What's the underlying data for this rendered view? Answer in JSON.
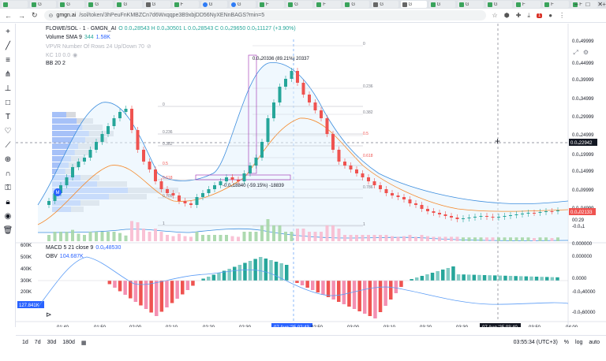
{
  "browser": {
    "tabs": [
      {
        "icon": "green",
        "label": ""
      },
      {
        "icon": "green",
        "label": "G"
      },
      {
        "icon": "green",
        "label": "G"
      },
      {
        "icon": "green",
        "label": "G"
      },
      {
        "icon": "green",
        "label": "G"
      },
      {
        "icon": "grey",
        "label": "G"
      },
      {
        "icon": "green",
        "label": "F"
      },
      {
        "icon": "blue",
        "label": "G"
      },
      {
        "icon": "blue",
        "label": "G"
      },
      {
        "icon": "green",
        "label": "F"
      },
      {
        "icon": "green",
        "label": "G"
      },
      {
        "icon": "green",
        "label": "F"
      },
      {
        "icon": "green",
        "label": "G"
      },
      {
        "icon": "grey",
        "label": "G"
      },
      {
        "icon": "grey",
        "label": "G"
      },
      {
        "icon": "green",
        "label": "G"
      },
      {
        "icon": "green",
        "label": "G"
      },
      {
        "icon": "green",
        "label": "G"
      },
      {
        "icon": "green",
        "label": "F"
      },
      {
        "icon": "green",
        "label": "F"
      },
      {
        "icon": "green",
        "label": "F"
      }
    ],
    "url_host": "gmgn.ai",
    "url_path": "/sol/token/3hPeuFnKMBZCn7d6Wxqqpe3B9xbjDD56NyXENnBAGS?min=5",
    "notif_badge": "1"
  },
  "legend": {
    "symbol": "FLOWE/SOL · 1 · GMGN_AI",
    "ohlc": "O 0.0₄28543 H 0.0₄30501 L 0.0₄28543 C 0.0₄29650 0.0₅11127 (+3.90%)",
    "volume_label": "Volume SMA 9",
    "volume_val1": "344",
    "volume_val2": "1.58K",
    "vpvr_label": "VPVR Number Of Rows 24 Up/Down 70",
    "kc_label": "KC 10 0.0",
    "bb_label": "BB 20 2",
    "macd_label": "MACD 5 21 close 9",
    "macd_val": "0.0₆48530",
    "obv_label": "OBV",
    "obv_val": "104.687K"
  },
  "chart_data": {
    "type": "candlestick",
    "title": "FLOWE/SOL · 1 · GMGN_AI",
    "x_ticks": [
      "01:40",
      "01:50",
      "02:00",
      "02:10",
      "02:20",
      "02:30",
      "07 Aug '25  02:43",
      "02:50",
      "03:00",
      "03:10",
      "03:20",
      "03:30",
      "07 Aug '25  03:40",
      "03:50",
      "04:00"
    ],
    "y_ticks_price": [
      "0.0₄49999",
      "0.0₄44999",
      "0.0₄39999",
      "0.0₄34999",
      "0.0₄29999",
      "0.0₄24999",
      "0.0₄22942",
      "0.0₄19999",
      "0.0₄14999",
      "0.0₄09999",
      "0.0₄04999",
      "0.0₄02133",
      "00:29",
      "-0.0₄1",
      "0.000000"
    ],
    "y_ticks_macd": [
      "0.000000",
      "0.0000",
      "-0.0₅40000",
      "-0.0₅40000",
      "-0.0₅60000"
    ],
    "obv_ticks": [
      "600K",
      "500K",
      "400K",
      "300K",
      "200K",
      "127.841K"
    ],
    "annotations": {
      "high_label": "0.0₄20336 (89.21%) 20337",
      "low_label": "-0.0₄18840 (-59.15%) -18839",
      "fib_levels": [
        "0",
        "0.236",
        "0.382",
        "0.5",
        "0.618",
        "0.786",
        "1"
      ],
      "fib_levels_right": [
        "0",
        "0.236",
        "0.382",
        "0.5",
        "0.618",
        "0.786",
        "1"
      ]
    },
    "current_price": "0.0₄02133",
    "crosshair_price": "0.0₄22942",
    "footer_time": "03:55:34 (UTC+3)",
    "scale_labels": [
      "%",
      "log",
      "auto"
    ],
    "timeframes": [
      "1d",
      "7d",
      "30d",
      "180d"
    ]
  },
  "colors": {
    "up": "#26a69a",
    "down": "#ef5350",
    "bb": "#3d8ede",
    "kc": "#f5892b",
    "vpvr_up": "#5c8ef2",
    "vpvr_down": "#b2b5be"
  }
}
